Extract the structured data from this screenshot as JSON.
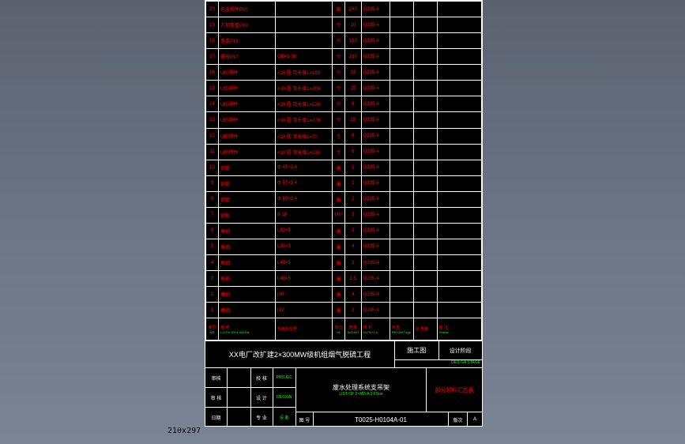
{
  "paper_size_label": "210x297",
  "header": {
    "no": "序号",
    "no_en": "NO",
    "name": "名 称",
    "name_en": "Lv1To+100 k i@ONL",
    "spec": "规格及型号",
    "spec_en": "",
    "unit": "单位",
    "unit_en": "he",
    "qty": "数量",
    "qty_en": "JoOUNT",
    "mat": "材 料",
    "mat_en": "Lv1To+1 k",
    "w1": "单重",
    "w1_en": "PW UNIT kgs",
    "w2": "总 重量",
    "w2_en": "",
    "remark": "备 注",
    "remark_en": "Rowns"
  },
  "rows": [
    {
      "no": "20",
      "name": "托座焊件P20",
      "spec": "",
      "unit": "套",
      "qty": "240",
      "mat": "Q235-A",
      "w1": "",
      "w2": "",
      "remark": ""
    },
    {
      "no": "19",
      "name": "方钢垫重P19",
      "spec": "",
      "unit": "个",
      "qty": "10",
      "mat": "Q235-A",
      "w1": "",
      "w2": "",
      "remark": ""
    },
    {
      "no": "18",
      "name": "垫重P18",
      "spec": "",
      "unit": "个",
      "qty": "160",
      "mat": "Q235-A",
      "w1": "",
      "w2": "",
      "remark": ""
    },
    {
      "no": "17",
      "name": "螺母P17",
      "spec": "GB41-86",
      "unit": "个",
      "qty": "160",
      "mat": "Q235-A",
      "w1": "",
      "w2": "",
      "remark": ""
    },
    {
      "no": "16",
      "name": "U形焊件",
      "spec": "#10 圆 弯长度L=155",
      "unit": "个",
      "qty": "33",
      "mat": "Q235-A",
      "w1": "",
      "w2": "",
      "remark": ""
    },
    {
      "no": "15",
      "name": "U形焊件",
      "spec": "#10 圆 弯长度L=280",
      "unit": "个",
      "qty": "25",
      "mat": "Q235-A",
      "w1": "",
      "w2": "",
      "remark": ""
    },
    {
      "no": "14",
      "name": "U形焊件",
      "spec": "#10 圆 弯长度L=230",
      "unit": "个",
      "qty": "6",
      "mat": "Q235-A",
      "w1": "",
      "w2": "",
      "remark": ""
    },
    {
      "no": "13",
      "name": "U形焊件",
      "spec": "#10 圆 弯长度L=270",
      "unit": "个",
      "qty": "28",
      "mat": "Q235-A",
      "w1": "",
      "w2": "",
      "remark": ""
    },
    {
      "no": "12",
      "name": "U形焊件",
      "spec": "#10 圆 弯长度L=70",
      "unit": "个",
      "qty": "8",
      "mat": "Q235-A",
      "w1": "",
      "w2": "",
      "remark": ""
    },
    {
      "no": "11",
      "name": "U形焊件",
      "spec": "#10 圆 弯长度L=230",
      "unit": "个",
      "qty": "6",
      "mat": "Q235-A",
      "w1": "",
      "w2": "",
      "remark": ""
    },
    {
      "no": "10",
      "name": "钢管",
      "spec": "Φ 45×3 4",
      "unit": "米",
      "qty": "1",
      "mat": "Q235-A",
      "w1": "",
      "w2": "",
      "remark": ""
    },
    {
      "no": "9",
      "name": "钢管",
      "spec": "Φ 57×3 4",
      "unit": "米",
      "qty": "2",
      "mat": "Q235-A",
      "w1": "",
      "w2": "",
      "remark": ""
    },
    {
      "no": "8",
      "name": "钢管",
      "spec": "Φ 89×3 4",
      "unit": "米",
      "qty": "2",
      "mat": "Q235-A",
      "w1": "",
      "w2": "",
      "remark": ""
    },
    {
      "no": "7",
      "name": "钢板",
      "spec": "8-10",
      "unit": "t/m²",
      "qty": "3",
      "mat": "Q235-A",
      "w1": "",
      "w2": "",
      "remark": ""
    },
    {
      "no": "6",
      "name": "角钢",
      "spec": "L50×5",
      "unit": "米",
      "qty": "3",
      "mat": "Q235-A",
      "w1": "",
      "w2": "",
      "remark": ""
    },
    {
      "no": "5",
      "name": "角钢",
      "spec": "L50×5",
      "unit": "米",
      "qty": "4",
      "mat": "Q235-A",
      "w1": "",
      "w2": "",
      "remark": ""
    },
    {
      "no": "4",
      "name": "角钢",
      "spec": "L40×5",
      "unit": "米",
      "qty": "3",
      "mat": "Q235-A",
      "w1": "",
      "w2": "",
      "remark": ""
    },
    {
      "no": "3",
      "name": "角钢",
      "spec": "L40×5",
      "unit": "米",
      "qty": "1.5",
      "mat": "Q235-A",
      "w1": "",
      "w2": "",
      "remark": ""
    },
    {
      "no": "2",
      "name": "槽钢",
      "spec": "[10",
      "unit": "米",
      "qty": "4",
      "mat": "Q235-A",
      "w1": "",
      "w2": "",
      "remark": ""
    },
    {
      "no": "1",
      "name": "槽钢",
      "spec": "[12",
      "unit": "米",
      "qty": "2",
      "mat": "Q235-A",
      "w1": "",
      "w2": "",
      "remark": ""
    }
  ],
  "titleblock": {
    "project": "XX电厂改扩建2×300MW级机组烟气脱硫工程",
    "stage1": "施工图",
    "stage2": "设计阶段",
    "stage2_en": "DES·GA STAGE",
    "sign": {
      "r1a": "审核",
      "r1b": "校 核",
      "r1b_en": "PROJEC",
      "r2a": "审 核",
      "r2b": "设 计",
      "r2b_en": "DESIGN",
      "r3a": "日期",
      "r3b": "专 业",
      "r3c": "设 备",
      "r3c_en": "ID"
    },
    "drawing_title": "废水处理系统支吊架",
    "drawing_title_en": "LIST OF 2×MD A 0 FSoe",
    "drawing_sub": "部分材料汇总表",
    "num_lbl": "图 号",
    "drawing_no": "T0025-H0104A-01",
    "rev_lbl": "版次",
    "rev": "A"
  }
}
